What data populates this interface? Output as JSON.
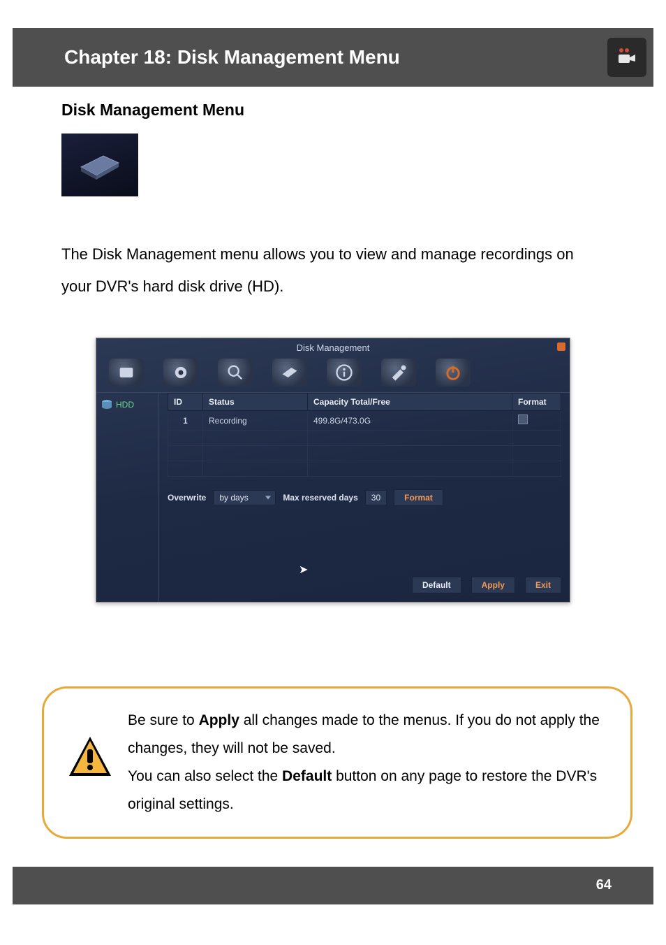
{
  "header": {
    "title": "Chapter 18: Disk Management Menu"
  },
  "section_title": "Disk Management Menu",
  "intro": "The Disk Management menu allows you to view and manage recordings on your DVR's hard disk drive (HD).",
  "screenshot": {
    "window_title": "Disk Management",
    "sidebar": {
      "item": "HDD"
    },
    "table": {
      "headers": [
        "ID",
        "Status",
        "Capacity Total/Free",
        "Format"
      ],
      "row": {
        "id": "1",
        "status": "Recording",
        "capacity": "499.8G/473.0G"
      }
    },
    "options": {
      "overwrite_label": "Overwrite",
      "overwrite_value": "by days",
      "max_days_label": "Max reserved days",
      "max_days_value": "30",
      "format_button": "Format"
    },
    "buttons": {
      "default": "Default",
      "apply": "Apply",
      "exit": "Exit"
    }
  },
  "callout": {
    "p1a": "Be sure to ",
    "p1b": "Apply",
    "p1c": " all changes made to the menus. If you do not apply the changes, they will not be saved.",
    "p2a": "You can also select the ",
    "p2b": "Default",
    "p2c": " button on any page to restore the DVR's original settings."
  },
  "page_number": "64"
}
